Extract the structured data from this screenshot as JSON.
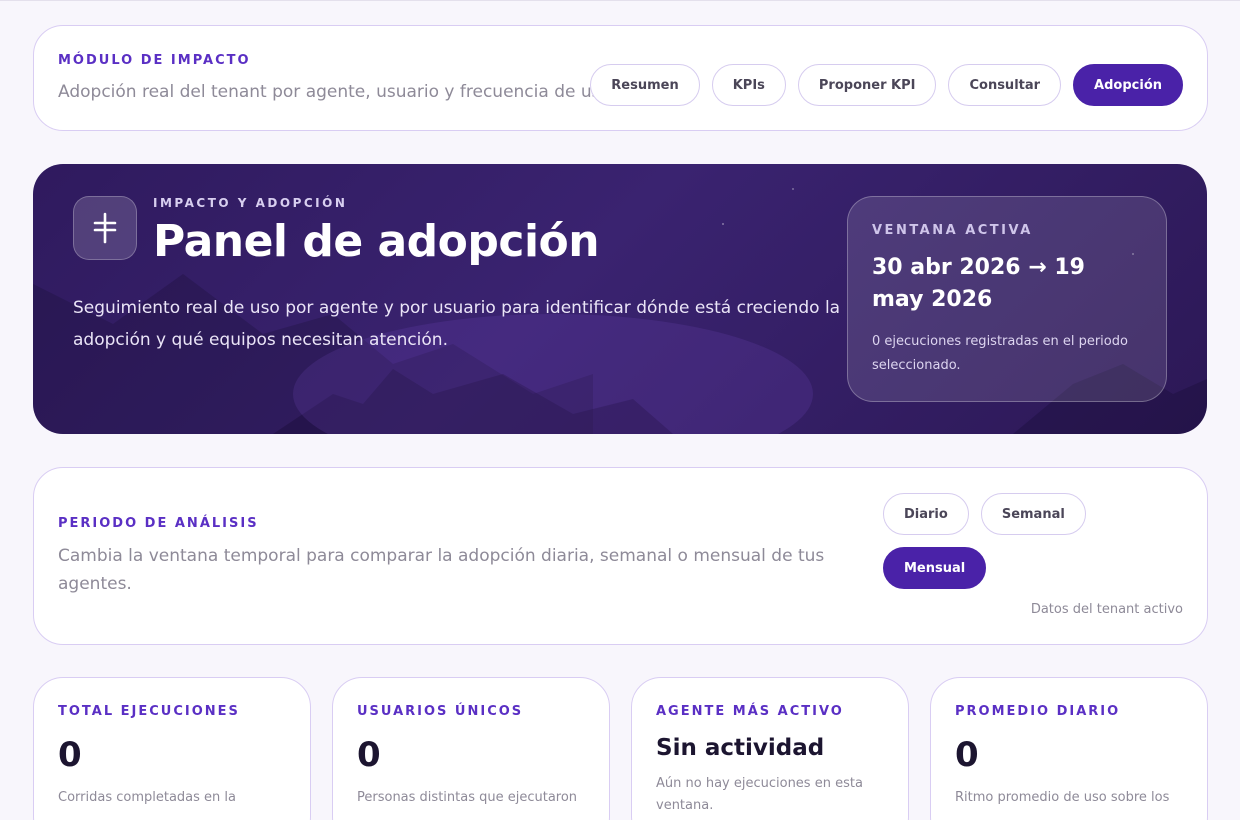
{
  "module": {
    "eyebrow": "MÓDULO DE IMPACTO",
    "subtitle": "Adopción real del tenant por agente, usuario y frecuencia de uso.",
    "tabs": [
      {
        "label": "Resumen",
        "active": false
      },
      {
        "label": "KPIs",
        "active": false
      },
      {
        "label": "Proponer KPI",
        "active": false
      },
      {
        "label": "Consultar",
        "active": false
      },
      {
        "label": "Adopción",
        "active": true
      }
    ]
  },
  "hero": {
    "icon": "adoption-dial-icon",
    "eyebrow": "IMPACTO Y ADOPCIÓN",
    "title": "Panel de adopción",
    "description": "Seguimiento real de uso por agente y por usuario para identificar dónde está creciendo la adopción y qué equipos necesitan atención.",
    "window": {
      "label": "VENTANA ACTIVA",
      "range": "30 abr 2026 → 19 may 2026",
      "note": "0 ejecuciones registradas en el periodo seleccionado."
    }
  },
  "period": {
    "eyebrow": "PERIODO DE ANÁLISIS",
    "subtitle": "Cambia la ventana temporal para comparar la adopción diaria, semanal o mensual de tus agentes.",
    "options": [
      {
        "label": "Diario",
        "active": false
      },
      {
        "label": "Semanal",
        "active": false
      },
      {
        "label": "Mensual",
        "active": true
      }
    ],
    "meta": "Datos del tenant activo"
  },
  "stats": [
    {
      "label": "TOTAL EJECUCIONES",
      "value": "0",
      "desc": "Corridas completadas en la"
    },
    {
      "label": "USUARIOS ÚNICOS",
      "value": "0",
      "desc": "Personas distintas que ejecutaron"
    },
    {
      "label": "AGENTE MÁS ACTIVO",
      "value": "Sin actividad",
      "desc": "Aún no hay ejecuciones en esta ventana."
    },
    {
      "label": "PROMEDIO DIARIO",
      "value": "0",
      "desc": "Ritmo promedio de uso sobre los"
    }
  ],
  "colors": {
    "accent": "#4a22a8",
    "eyebrow": "#5a2fc4",
    "hero_bg": "#2f1a5e",
    "card_border": "#d9cdf3",
    "page_bg": "#f8f6fc"
  }
}
